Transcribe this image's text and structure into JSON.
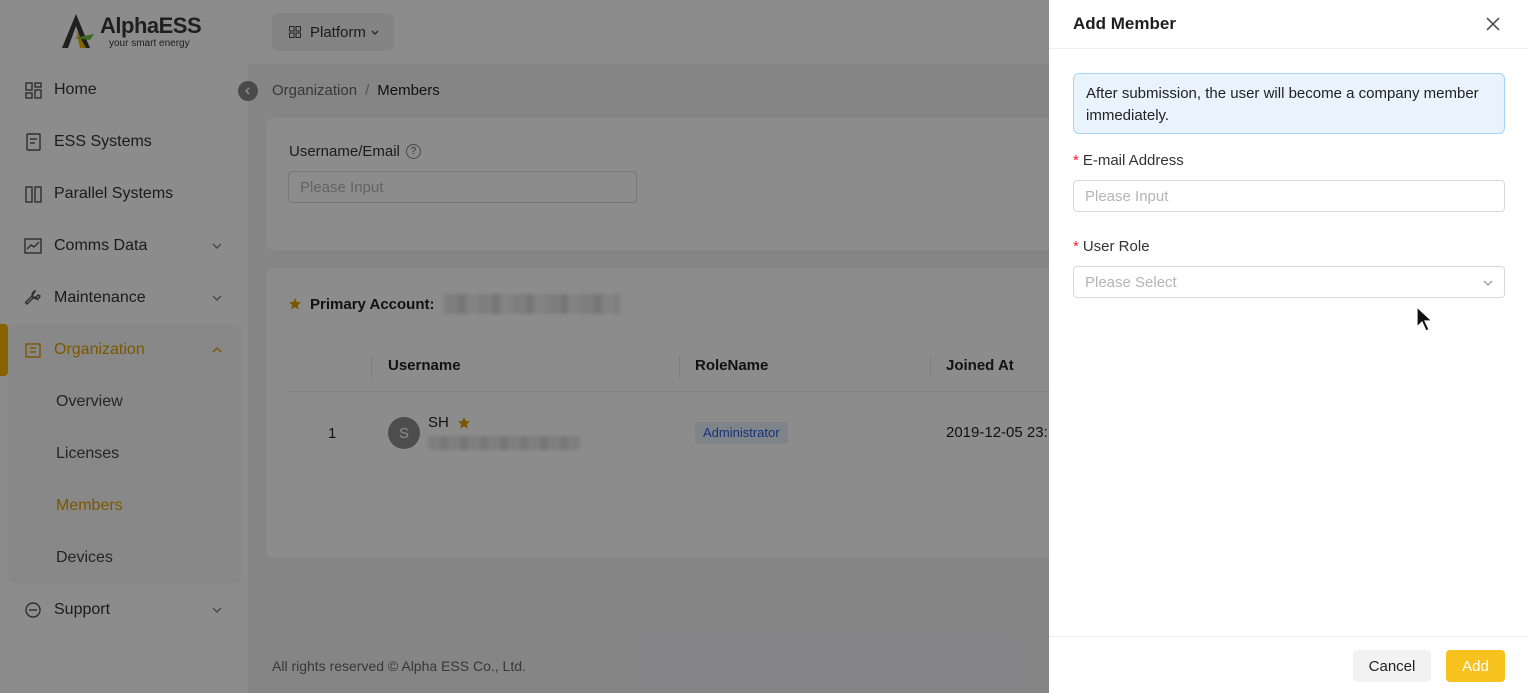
{
  "brand": {
    "name": "AlphaESS",
    "tagline": "your smart energy"
  },
  "topbar": {
    "platform_label": "Platform"
  },
  "sidebar": {
    "items": [
      {
        "label": "Home",
        "icon": "home-icon"
      },
      {
        "label": "ESS Systems",
        "icon": "ess-icon"
      },
      {
        "label": "Parallel Systems",
        "icon": "parallel-icon"
      },
      {
        "label": "Comms Data",
        "icon": "chart-icon"
      },
      {
        "label": "Maintenance",
        "icon": "wrench-icon"
      },
      {
        "label": "Organization",
        "icon": "building-icon"
      },
      {
        "label": "Support",
        "icon": "chat-icon"
      }
    ],
    "sub_items": [
      "Overview",
      "Licenses",
      "Members",
      "Devices"
    ],
    "active_item": "Organization",
    "active_sub_item": "Members"
  },
  "breadcrumb": {
    "parent": "Organization",
    "separator": "/",
    "current": "Members"
  },
  "search": {
    "label": "Username/Email",
    "placeholder": "Please Input"
  },
  "primary_account": {
    "label": "Primary Account:"
  },
  "table": {
    "columns": [
      "Username",
      "RoleName",
      "Joined At"
    ],
    "rows": [
      {
        "index": "1",
        "avatar_letter": "S",
        "username": "SH",
        "role": "Administrator",
        "joined_at": "2019-12-05 23:"
      }
    ]
  },
  "footer": {
    "text": "All rights reserved © Alpha ESS Co., Ltd."
  },
  "drawer": {
    "title": "Add Member",
    "notice": "After submission, the user will become a company member immediately.",
    "email_label": "E-mail Address",
    "email_placeholder": "Please Input",
    "role_label": "User Role",
    "role_placeholder": "Please Select",
    "required_mark": "*",
    "cancel_label": "Cancel",
    "add_label": "Add"
  },
  "colors": {
    "accent": "#f4b400",
    "add_button": "#f7c21e",
    "notice_bg": "#e8f3fd",
    "tag_text": "#2a5bd7"
  }
}
